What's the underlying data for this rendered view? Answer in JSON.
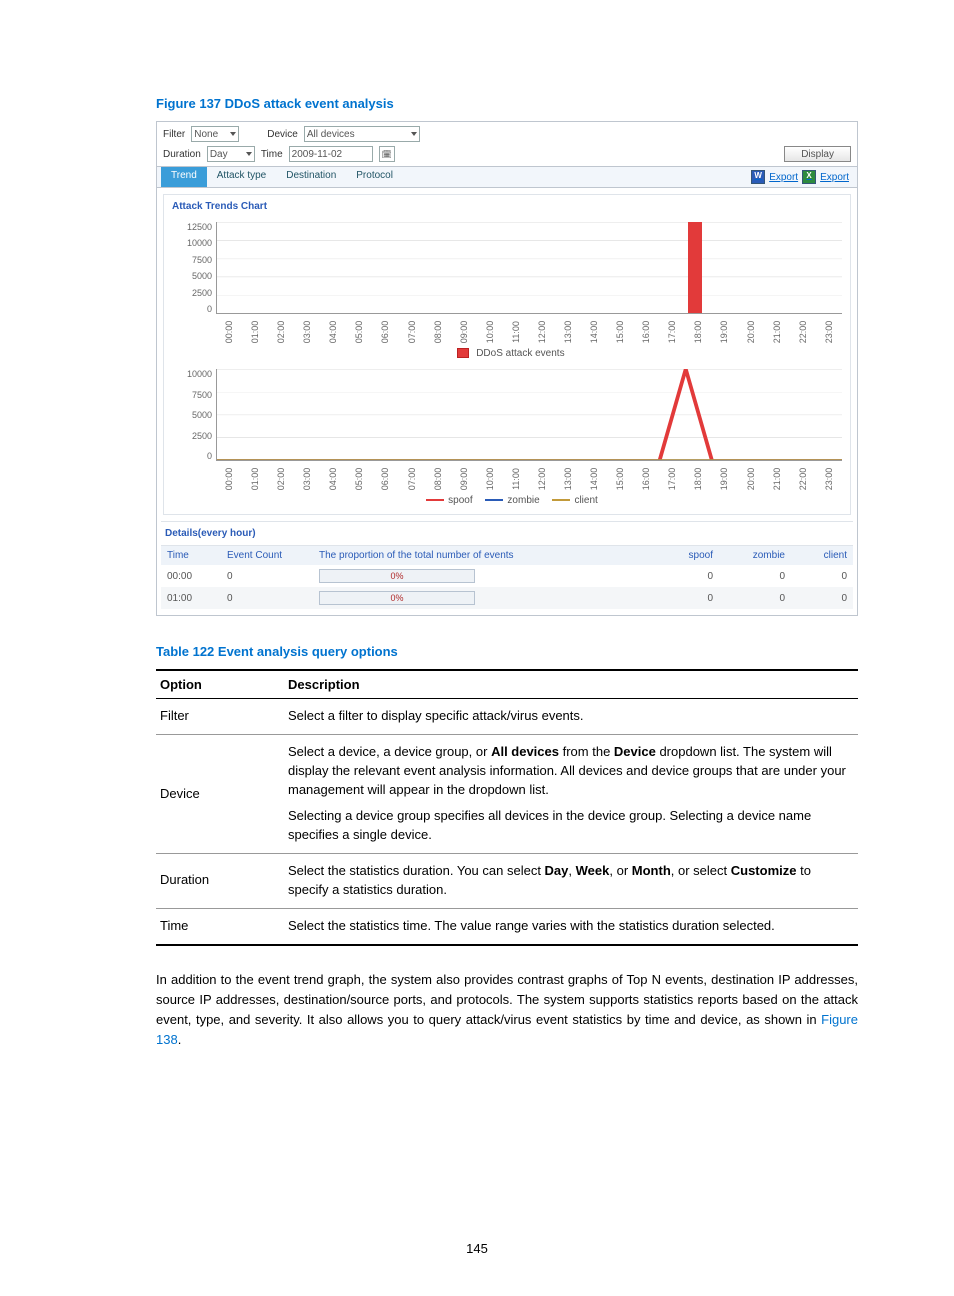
{
  "figure": {
    "title": "Figure 137 DDoS attack event analysis",
    "filter_label": "Filter",
    "filter_value": "None",
    "device_label": "Device",
    "device_value": "All devices",
    "duration_label": "Duration",
    "duration_value": "Day",
    "time_label": "Time",
    "time_value": "2009-11-02",
    "display_button": "Display",
    "tabs": [
      "Trend",
      "Attack type",
      "Destination",
      "Protocol"
    ],
    "export_label": "Export"
  },
  "chart_data": [
    {
      "type": "bar",
      "title": "Attack Trends Chart",
      "categories": [
        "00:00",
        "01:00",
        "02:00",
        "03:00",
        "04:00",
        "05:00",
        "06:00",
        "07:00",
        "08:00",
        "09:00",
        "10:00",
        "11:00",
        "12:00",
        "13:00",
        "14:00",
        "15:00",
        "16:00",
        "17:00",
        "18:00",
        "19:00",
        "20:00",
        "21:00",
        "22:00",
        "23:00"
      ],
      "values": [
        0,
        0,
        0,
        0,
        0,
        0,
        0,
        0,
        0,
        0,
        0,
        0,
        0,
        0,
        0,
        0,
        0,
        0,
        12500,
        0,
        0,
        0,
        0,
        0
      ],
      "ylabel": "",
      "ylim": [
        0,
        12500
      ],
      "yticks": [
        12500,
        10000,
        7500,
        5000,
        2500,
        0
      ],
      "legend": [
        "DDoS attack events"
      ],
      "colors": [
        "#e23a3a"
      ]
    },
    {
      "type": "line",
      "categories": [
        "00:00",
        "01:00",
        "02:00",
        "03:00",
        "04:00",
        "05:00",
        "06:00",
        "07:00",
        "08:00",
        "09:00",
        "10:00",
        "11:00",
        "12:00",
        "13:00",
        "14:00",
        "15:00",
        "16:00",
        "17:00",
        "18:00",
        "19:00",
        "20:00",
        "21:00",
        "22:00",
        "23:00"
      ],
      "series": [
        {
          "name": "spoof",
          "color": "#e23a3a",
          "values": [
            0,
            0,
            0,
            0,
            0,
            0,
            0,
            0,
            0,
            0,
            0,
            0,
            0,
            0,
            0,
            0,
            0,
            0,
            10000,
            0,
            0,
            0,
            0,
            0
          ]
        },
        {
          "name": "zombie",
          "color": "#2a5bb7",
          "values": [
            0,
            0,
            0,
            0,
            0,
            0,
            0,
            0,
            0,
            0,
            0,
            0,
            0,
            0,
            0,
            0,
            0,
            0,
            0,
            0,
            0,
            0,
            0,
            0
          ]
        },
        {
          "name": "client",
          "color": "#c29a3a",
          "values": [
            0,
            0,
            0,
            0,
            0,
            0,
            0,
            0,
            0,
            0,
            0,
            0,
            0,
            0,
            0,
            0,
            0,
            0,
            0,
            0,
            0,
            0,
            0,
            0
          ]
        }
      ],
      "ylim": [
        0,
        10000
      ],
      "yticks": [
        10000,
        7500,
        5000,
        2500,
        0
      ]
    }
  ],
  "details": {
    "title": "Details(every hour)",
    "columns": [
      "Time",
      "Event Count",
      "The proportion of the total number of events",
      "spoof",
      "zombie",
      "client"
    ],
    "rows": [
      {
        "time": "00:00",
        "count": "0",
        "prop": "0%",
        "spoof": "0",
        "zombie": "0",
        "client": "0"
      },
      {
        "time": "01:00",
        "count": "0",
        "prop": "0%",
        "spoof": "0",
        "zombie": "0",
        "client": "0"
      }
    ]
  },
  "table": {
    "title": "Table 122 Event analysis query options",
    "header": [
      "Option",
      "Description"
    ],
    "rows": [
      {
        "option": "Filter",
        "desc": "Select a filter to display specific attack/virus events."
      },
      {
        "option": "Device",
        "desc_parts": [
          "Select a device, a device group, or ",
          "All devices",
          " from the ",
          "Device",
          " dropdown list. The system will display the relevant event analysis information. All devices and device groups that are under your management will appear in the dropdown list."
        ],
        "desc2": "Selecting a device group specifies all devices in the device group. Selecting a device name specifies a single device."
      },
      {
        "option": "Duration",
        "desc_parts": [
          "Select the statistics duration. You can select ",
          "Day",
          ", ",
          "Week",
          ", or ",
          "Month",
          ", or select ",
          "Customize",
          " to specify a statistics duration."
        ]
      },
      {
        "option": "Time",
        "desc": "Select the statistics time. The value range varies with the statistics duration selected."
      }
    ]
  },
  "paragraph": {
    "pre": "In addition to the event trend graph, the system also provides contrast graphs of Top N events, destination IP addresses, source IP addresses, destination/source ports, and protocols. The system supports statistics reports based on the attack event, type, and severity. It also allows you to query attack/virus event statistics by time and device, as shown in ",
    "link": "Figure 138",
    "post": "."
  },
  "page_number": "145"
}
